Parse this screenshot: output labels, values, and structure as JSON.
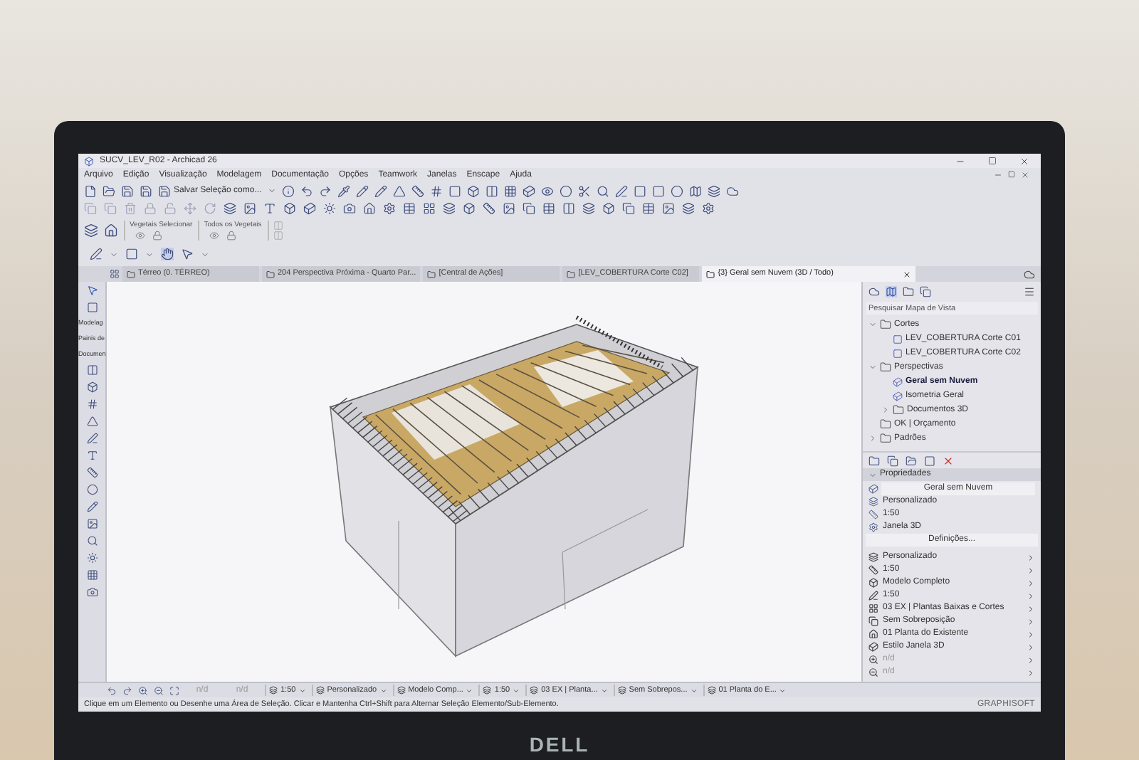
{
  "window": {
    "title": "SUCV_LEV_R02 - Archicad 26"
  },
  "menu": [
    "Arquivo",
    "Edição",
    "Visualização",
    "Modelagem",
    "Documentação",
    "Opções",
    "Teamwork",
    "Janelas",
    "Enscape",
    "Ajuda"
  ],
  "toolbar": {
    "save_selection": "Salvar Seleção como...",
    "groups": [
      "Vegetais Selecionar",
      "Todos os Vegetais"
    ]
  },
  "toolbox": {
    "palettes": [
      "Modelag",
      "Painis de",
      "Documen"
    ]
  },
  "tabs": [
    {
      "label": "Térreo (0. TÉRREO)",
      "selected": false
    },
    {
      "label": "204 Perspectiva Próxima - Quarto Par...",
      "selected": false
    },
    {
      "label": "[Central de Ações]",
      "selected": false
    },
    {
      "label": "[LEV_COBERTURA Corte C02]",
      "selected": false
    },
    {
      "label": "{3} Geral sem Nuvem (3D / Todo)",
      "selected": true
    }
  ],
  "navigator": {
    "search": {
      "placeholder": "Pesquisar Mapa de Vista"
    },
    "tree": [
      {
        "label": "Cortes",
        "kind": "folder",
        "expanded": true,
        "selected": false,
        "children": [
          {
            "label": "LEV_COBERTURA Corte C01",
            "kind": "section",
            "selected": false
          },
          {
            "label": "LEV_COBERTURA Corte C02",
            "kind": "section",
            "selected": false
          }
        ]
      },
      {
        "label": "Perspectivas",
        "kind": "folder",
        "expanded": true,
        "selected": false,
        "children": [
          {
            "label": "Geral sem Nuvem",
            "kind": "view3d",
            "selected": true
          },
          {
            "label": "Isometria Geral",
            "kind": "view3d",
            "selected": false
          },
          {
            "label": "Documentos 3D",
            "kind": "folder",
            "expanded": false,
            "selected": false
          }
        ]
      },
      {
        "label": "OK | Orçamento",
        "kind": "folder",
        "selected": false
      },
      {
        "label": "Padrões",
        "kind": "folder",
        "expanded": false,
        "selected": false
      }
    ]
  },
  "properties": {
    "header": "Propriedades",
    "expanded": true,
    "name_field": "Geral sem Nuvem",
    "rows": [
      "Personalizado",
      "1:50",
      "Janela 3D"
    ],
    "button": "Definições...",
    "settings": [
      "Personalizado",
      "1:50",
      "Modelo Completo",
      "1:50",
      "03 EX | Plantas Baixas e Cortes",
      "Sem Sobreposição",
      "01 Planta do Existente",
      "Estilo Janela 3D",
      "n/d",
      "n/d"
    ]
  },
  "quick_options": [
    {
      "kind": "field",
      "label": "n/d"
    },
    {
      "kind": "field",
      "label": "n/d"
    },
    {
      "kind": "dropdown",
      "label": "1:50"
    },
    {
      "kind": "dropdown",
      "label": "Personalizado"
    },
    {
      "kind": "dropdown",
      "label": "Modelo Comp..."
    },
    {
      "kind": "dropdown",
      "label": "1:50"
    },
    {
      "kind": "dropdown",
      "label": "03 EX | Planta..."
    },
    {
      "kind": "dropdown",
      "label": "Sem Sobrepos..."
    },
    {
      "kind": "dropdown",
      "label": "01 Planta do E..."
    }
  ],
  "status_bar": "Clique em um Elemento ou Desenhe uma Área de Seleção. Clicar e Mantenha Ctrl+Shift para Alternar Seleção Elemento/Sub-Elemento.",
  "brand": {
    "vendor": "GRAPHISOFT",
    "laptop": "DELL"
  }
}
